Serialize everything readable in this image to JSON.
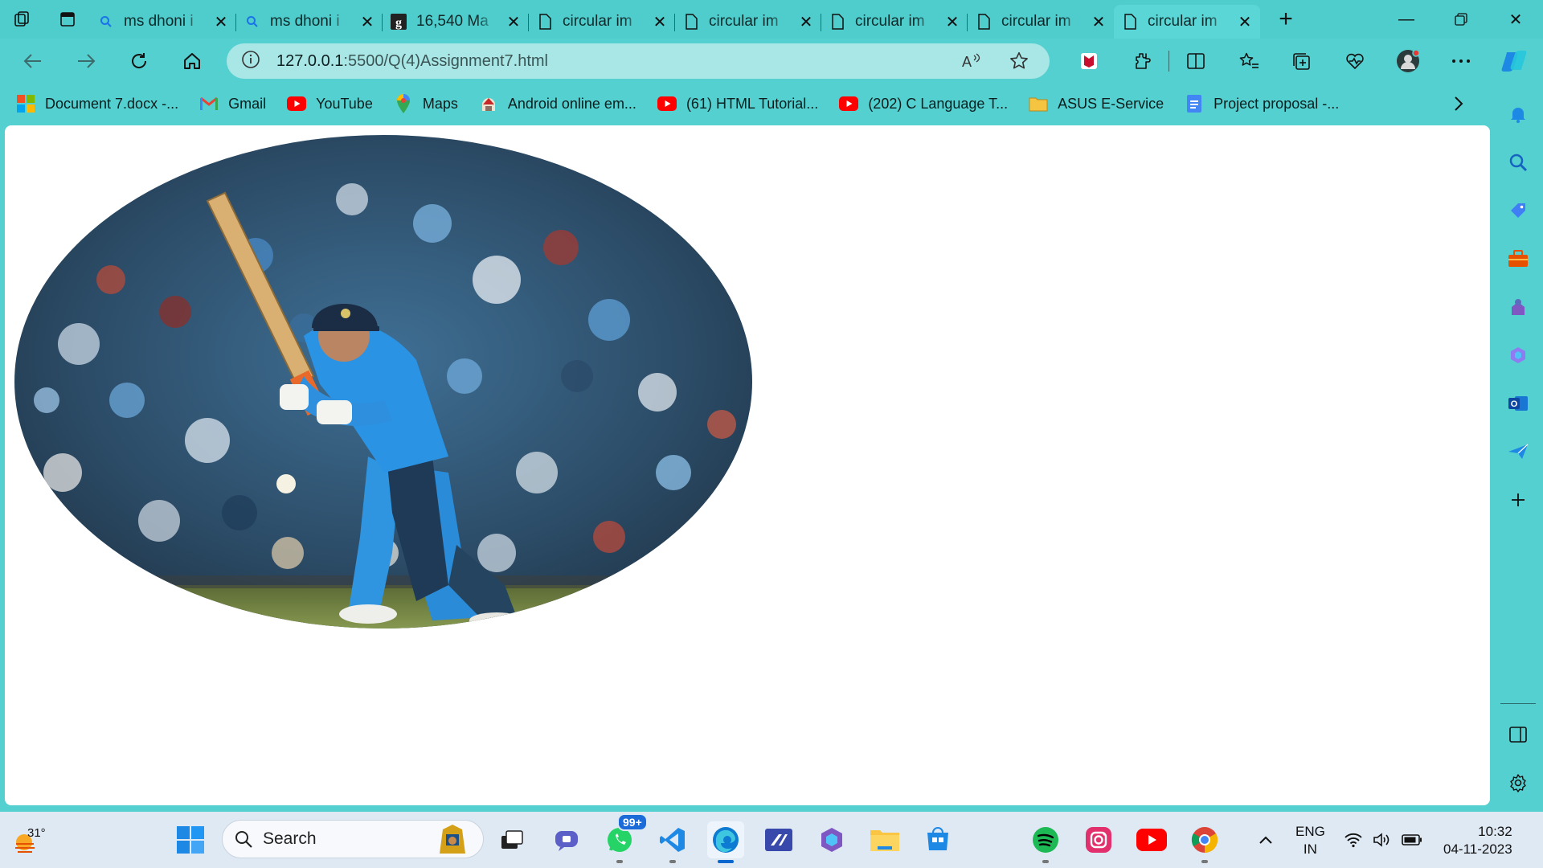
{
  "tabs": [
    {
      "title": "ms dhoni i",
      "icon": "search-icon",
      "active": false
    },
    {
      "title": "ms dhoni i",
      "icon": "search-icon",
      "active": false
    },
    {
      "title": "16,540 Ma",
      "icon": "g-icon",
      "active": false
    },
    {
      "title": "circular im",
      "icon": "page-icon",
      "active": false
    },
    {
      "title": "circular im",
      "icon": "page-icon",
      "active": false
    },
    {
      "title": "circular im",
      "icon": "page-icon",
      "active": false
    },
    {
      "title": "circular im",
      "icon": "page-icon",
      "active": false
    },
    {
      "title": "circular im",
      "icon": "page-icon",
      "active": true
    }
  ],
  "address": {
    "host": "127.0.0.1",
    "rest": ":5500/Q(4)Assignment7.html"
  },
  "bookmarks": [
    {
      "label": "Document 7.docx -...",
      "icon": "microsoft-icon"
    },
    {
      "label": "Gmail",
      "icon": "gmail-icon"
    },
    {
      "label": "YouTube",
      "icon": "youtube-icon"
    },
    {
      "label": "Maps",
      "icon": "maps-icon"
    },
    {
      "label": "Android online em...",
      "icon": "android-icon"
    },
    {
      "label": "(61) HTML Tutorial...",
      "icon": "youtube-icon"
    },
    {
      "label": "(202) C Language T...",
      "icon": "youtube-icon"
    },
    {
      "label": "ASUS E-Service",
      "icon": "folder-icon"
    },
    {
      "label": "Project proposal -...",
      "icon": "docs-icon"
    }
  ],
  "taskbar": {
    "weather_temp": "31°",
    "search_placeholder": "Search",
    "whatsapp_badge": "99+",
    "lang_line1": "ENG",
    "lang_line2": "IN",
    "time": "10:32",
    "date": "04-11-2023"
  },
  "colors": {
    "chrome": "#55d0d0",
    "accent": "#0b67d0"
  }
}
